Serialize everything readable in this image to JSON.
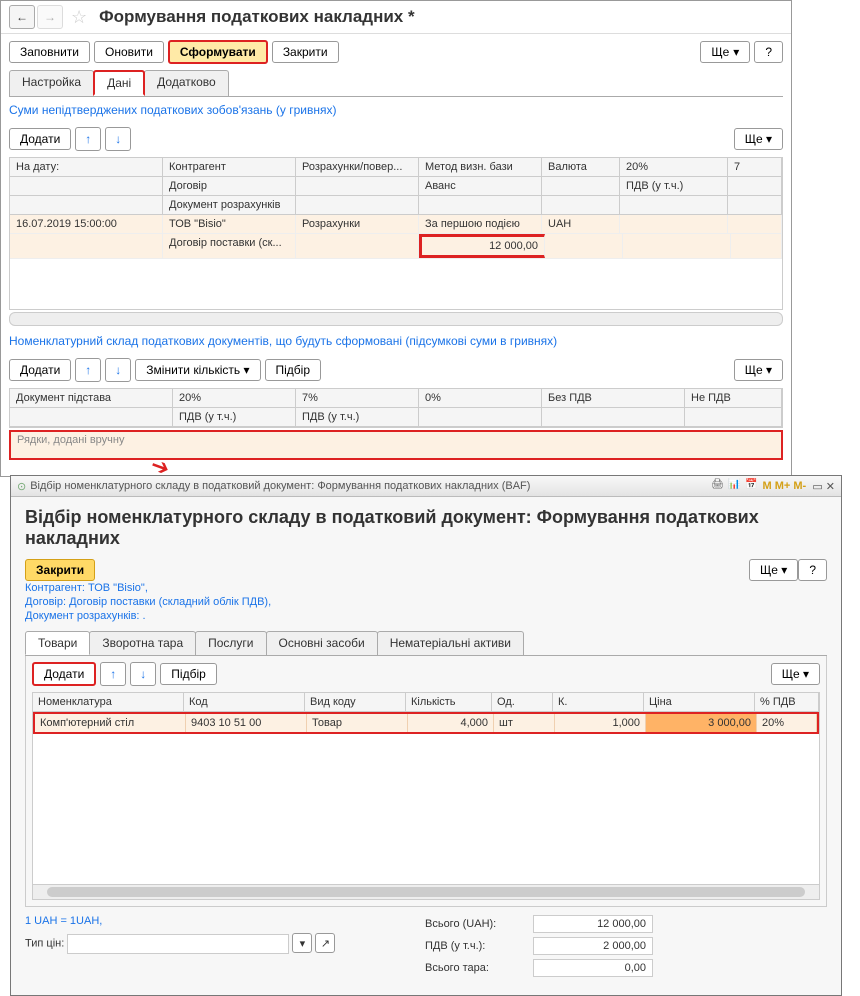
{
  "header": {
    "title": "Формування податкових накладних *"
  },
  "toolbar": {
    "fill": "Заповнити",
    "refresh": "Оновити",
    "form": "Сформувати",
    "close": "Закрити",
    "more": "Ще",
    "help": "?"
  },
  "tabs": {
    "setup": "Настройка",
    "data": "Дані",
    "extra": "Додатково"
  },
  "section1": {
    "title": "Суми непідтверджених податкових зобов'язань (у гривнях)",
    "add": "Додати",
    "more": "Ще ▾",
    "cols": {
      "date": "На дату:",
      "counterparty": "Контрагент",
      "agreement": "Договір",
      "doc": "Документ розрахунків",
      "calc": "Розрахунки/повер...",
      "method": "Метод визн. бази",
      "advance": "Аванс",
      "currency": "Валюта",
      "pct20": "20%",
      "vat": "ПДВ (у т.ч.)",
      "pct7": "7"
    },
    "row": {
      "date": "16.07.2019 15:00:00",
      "counterparty": "ТОВ \"Bisio\"",
      "agreement": "Договір поставки (ск...",
      "calc": "Розрахунки",
      "method": "За першою подією",
      "currency": "UAH",
      "amount": "12 000,00"
    }
  },
  "section2": {
    "title": "Номенклатурний склад податкових документів, що будуть сформовані (підсумкові суми в гривнях)",
    "add": "Додати",
    "chgqty": "Змінити кількість ▾",
    "select": "Підбір",
    "more": "Ще ▾",
    "cols": {
      "doc": "Документ підстава",
      "p20": "20%",
      "v20": "ПДВ (у т.ч.)",
      "p7": "7%",
      "v7": "ПДВ (у т.ч.)",
      "p0": "0%",
      "novat": "Без ПДВ",
      "notvat": "Не ПДВ"
    },
    "manual": "Рядки, додані вручну"
  },
  "subwindow": {
    "titlebar": "Відбір номенклатурного складу в податковий  документ: Формування податкових накладних  (BAF)",
    "title": "Відбір номенклатурного складу в податковий  документ: Формування податкових накладних",
    "close": "Закрити",
    "more": "Ще ▾",
    "help": "?",
    "info1": "Контрагент: ТОВ \"Bisio\",",
    "info2": "Договір: Договір поставки (складний облік ПДВ),",
    "info3": "Документ розрахунків: .",
    "tabs": {
      "goods": "Товари",
      "tare": "Зворотна тара",
      "services": "Послуги",
      "fixed": "Основні засоби",
      "intangible": "Нематеріальні активи"
    },
    "inner": {
      "add": "Додати",
      "select": "Підбір",
      "more": "Ще ▾"
    },
    "gcols": {
      "nom": "Номенклатура",
      "code": "Код",
      "kind": "Вид коду",
      "qty": "Кількість",
      "unit": "Од.",
      "k": "К.",
      "price": "Ціна",
      "vatpct": "% ПДВ"
    },
    "grow": {
      "nom": "Комп'ютерний стіл",
      "code": "9403 10 51 00",
      "kind": "Товар",
      "qty": "4,000",
      "unit": "шт",
      "k": "1,000",
      "price": "3 000,00",
      "vatpct": "20%"
    },
    "rate": "1 UAH = 1UAH,",
    "pricetype": "Тип цін:",
    "tot": {
      "total_l": "Всього (UAH):",
      "total": "12 000,00",
      "vat_l": "ПДВ (у т.ч.):",
      "vat": "2 000,00",
      "tare_l": "Всього тара:",
      "tare": "0,00"
    }
  },
  "icons": {
    "up": "↑",
    "down": "↓",
    "dd": "▾",
    "left": "←",
    "right": "→"
  }
}
